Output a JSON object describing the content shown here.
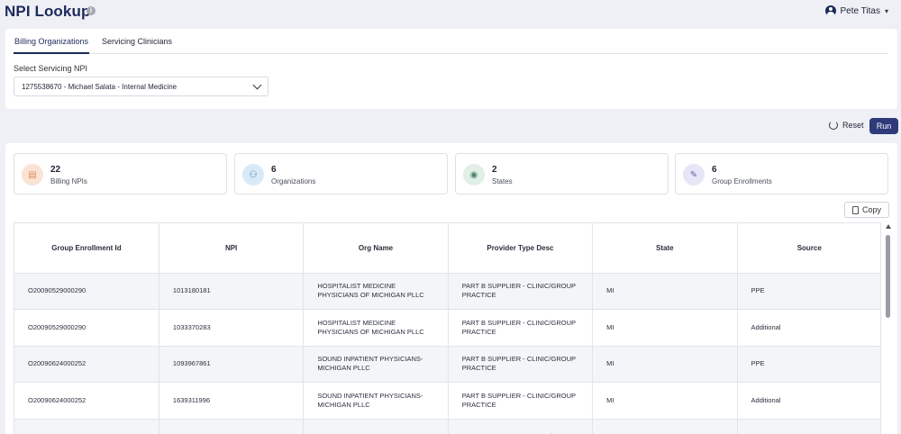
{
  "header": {
    "title": "NPI Lookup",
    "info_icon": "i",
    "user_name": "Pete Titas",
    "user_caret": "▾"
  },
  "tabs": [
    {
      "label": "Billing Organizations",
      "active": true
    },
    {
      "label": "Servicing Clinicians",
      "active": false
    }
  ],
  "select": {
    "label": "Select Servicing NPI",
    "value": "1275538670 - Michael Salata - Internal Medicine"
  },
  "actions": {
    "reset_label": "Reset",
    "run_label": "Run",
    "copy_label": "Copy"
  },
  "stats": [
    {
      "value": "22",
      "label": "Billing NPIs",
      "icon": "document-icon",
      "color": "#fbe3d4",
      "icon_color": "#e0885a"
    },
    {
      "value": "6",
      "label": "Organizations",
      "icon": "org-icon",
      "color": "#d8eaf7",
      "icon_color": "#3b7fb5"
    },
    {
      "value": "2",
      "label": "States",
      "icon": "location-icon",
      "color": "#e1efe6",
      "icon_color": "#4d8463"
    },
    {
      "value": "6",
      "label": "Group Enrollments",
      "icon": "enrollment-icon",
      "color": "#e6e6f6",
      "icon_color": "#5e61a8"
    }
  ],
  "table": {
    "columns": [
      "Group Enrollment Id",
      "NPI",
      "Org Name",
      "Provider Type Desc",
      "State",
      "Source"
    ],
    "rows": [
      [
        "O20090529000290",
        "1013180181",
        "HOSPITALIST MEDICINE PHYSICIANS OF MICHIGAN PLLC",
        "PART B SUPPLIER - CLINIC/GROUP PRACTICE",
        "MI",
        "PPE"
      ],
      [
        "O20090529000290",
        "1033370283",
        "HOSPITALIST MEDICINE PHYSICIANS OF MICHIGAN PLLC",
        "PART B SUPPLIER - CLINIC/GROUP PRACTICE",
        "MI",
        "Additional"
      ],
      [
        "O20090624000252",
        "1093967861",
        "SOUND INPATIENT PHYSICIANS-MICHIGAN PLLC",
        "PART B SUPPLIER - CLINIC/GROUP PRACTICE",
        "MI",
        "PPE"
      ],
      [
        "O20090624000252",
        "1639311996",
        "SOUND INPATIENT PHYSICIANS-MICHIGAN PLLC",
        "PART B SUPPLIER - CLINIC/GROUP PRACTICE",
        "MI",
        "Additional"
      ],
      [
        "",
        "",
        "SOUND INPATIENT PHYSICIANS-",
        "PART B SUPPLIER - CLINIC/GROUP",
        "",
        ""
      ]
    ]
  }
}
